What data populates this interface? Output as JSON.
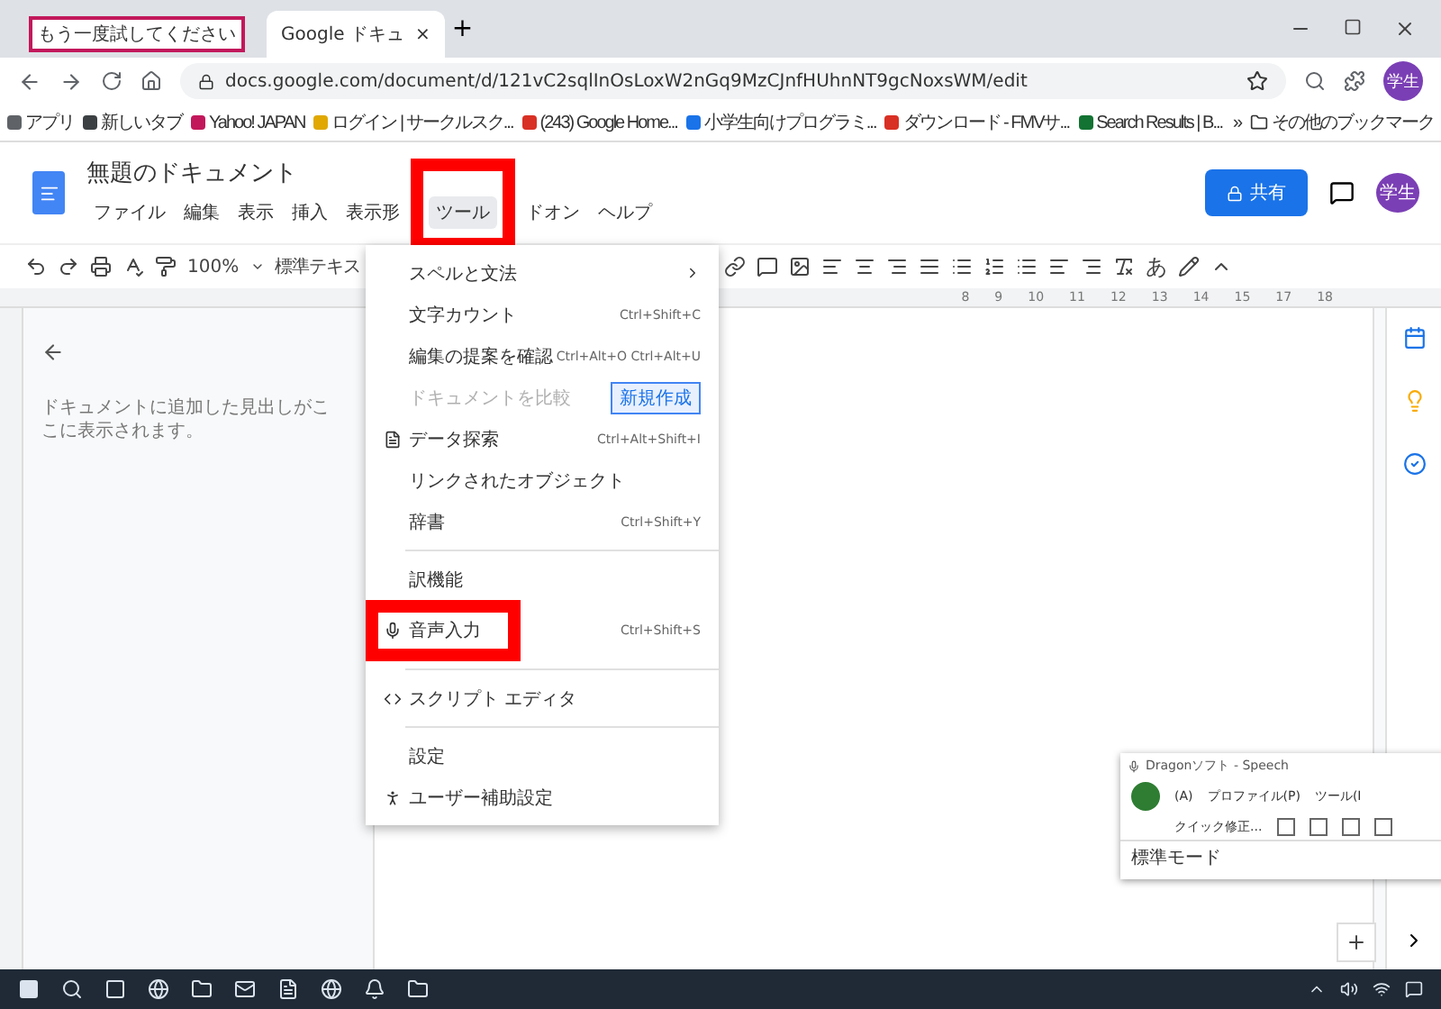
{
  "browser": {
    "tabs": [
      {
        "label": "もう一度試してください",
        "selected": false,
        "kind": "alert"
      },
      {
        "label": "Google ドキュ",
        "selected": true,
        "kind": "doc",
        "close": "×"
      }
    ],
    "new_tab": "+",
    "url": "docs.google.com/document/d/121vC2sqlInOsLoxW2nGq9MzCJnfHUhnNT9gcNoxsWM/edit",
    "profile": "学生",
    "account": "学生",
    "bookmarks": [
      {
        "label": "アプリ",
        "color": "#5f6368"
      },
      {
        "label": "新しいタブ",
        "color": "#3c4043"
      },
      {
        "label": "Yahoo! JAPAN",
        "color": "#c2185b"
      },
      {
        "label": "ログイン | サークルスク...",
        "color": "#e0a800"
      },
      {
        "label": "(243) Google Home...",
        "color": "#d93025"
      },
      {
        "label": "小学生向けプログラミ...",
        "color": "#1a73e8"
      },
      {
        "label": "ダウンロード - FMVサ...",
        "color": "#d93025"
      },
      {
        "label": "Search Results | B...",
        "color": "#137333"
      }
    ],
    "more_bookmarks": "»",
    "other_bookmarks": "その他のブックマーク"
  },
  "doc": {
    "title": "無題のドキュメント",
    "menus": [
      {
        "label": "ファイル",
        "selected": false,
        "annotated": false
      },
      {
        "label": "編集",
        "selected": false,
        "annotated": false
      },
      {
        "label": "表示",
        "selected": false,
        "annotated": false
      },
      {
        "label": "挿入",
        "selected": false,
        "annotated": false
      },
      {
        "label": "表示形",
        "selected": false,
        "annotated": false
      },
      {
        "label": "ツール",
        "selected": true,
        "annotated": true
      },
      {
        "label": "ドオン",
        "selected": false,
        "annotated": false
      },
      {
        "label": "ヘルプ",
        "selected": false,
        "annotated": false
      }
    ],
    "share": "共有",
    "zoom": "100%",
    "style": "標準テキス",
    "input_tool": "あ",
    "ruler": [
      "8",
      "9",
      "10",
      "11",
      "12",
      "13",
      "14",
      "15",
      "17",
      "18"
    ],
    "outline_hint": "ドキュメントに追加した見出しがここに表示されます。"
  },
  "tools_menu": [
    {
      "kind": "item",
      "label": "スペルと文法",
      "submenu": true,
      "disabled": false,
      "annotated": false
    },
    {
      "kind": "item",
      "label": "文字カウント",
      "shortcut": "Ctrl+Shift+C",
      "submenu": false,
      "disabled": false,
      "annotated": false
    },
    {
      "kind": "item",
      "label": "編集の提案を確認",
      "shortcut": "Ctrl+Alt+O Ctrl+Alt+U",
      "submenu": false,
      "disabled": false,
      "annotated": false
    },
    {
      "kind": "item",
      "label": "ドキュメントを比較",
      "badge": "新規作成",
      "submenu": false,
      "disabled": true,
      "annotated": false
    },
    {
      "kind": "item",
      "label": "データ探索",
      "shortcut": "Ctrl+Alt+Shift+I",
      "submenu": false,
      "disabled": false,
      "annotated": false
    },
    {
      "kind": "item",
      "label": "リンクされたオブジェクト",
      "submenu": false,
      "disabled": false,
      "annotated": false
    },
    {
      "kind": "item",
      "label": "辞書",
      "shortcut": "Ctrl+Shift+Y",
      "submenu": false,
      "disabled": false,
      "annotated": false
    },
    {
      "kind": "divider"
    },
    {
      "kind": "item",
      "label": "訳機能",
      "submenu": false,
      "disabled": false,
      "annotated": false
    },
    {
      "kind": "item",
      "label": "音声入力",
      "shortcut": "Ctrl+Shift+S",
      "submenu": false,
      "disabled": false,
      "annotated": true
    },
    {
      "kind": "divider"
    },
    {
      "kind": "item",
      "label": "スクリプト エディタ",
      "submenu": false,
      "disabled": false,
      "annotated": false
    },
    {
      "kind": "divider"
    },
    {
      "kind": "item",
      "label": "設定",
      "submenu": false,
      "disabled": false,
      "annotated": false
    },
    {
      "kind": "item",
      "label": "ユーザー補助設定",
      "submenu": false,
      "disabled": false,
      "annotated": false
    }
  ],
  "dragon": {
    "title": "Dragonソフト - Speech",
    "menus": [
      "(A)",
      "プロファイル(P)",
      "ツール(I"
    ],
    "quick": "クイック修正...",
    "mode": "標準モード"
  }
}
